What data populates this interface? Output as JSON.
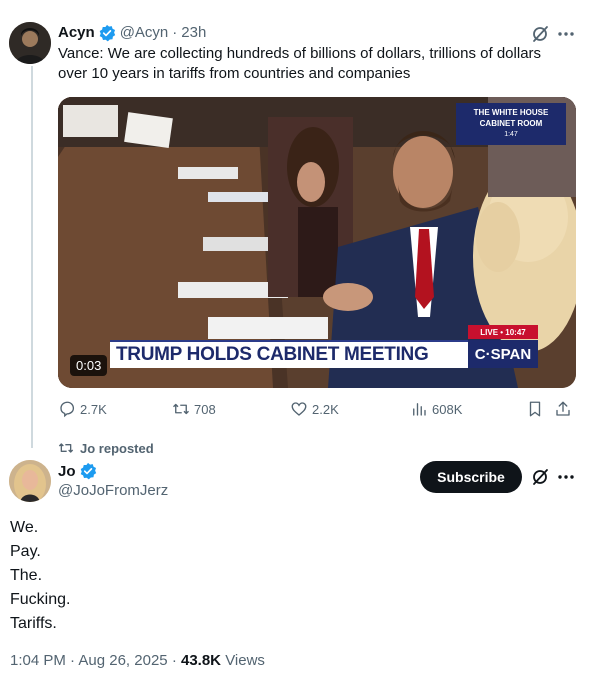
{
  "quoted_tweet": {
    "name": "Acyn",
    "handle": "@Acyn",
    "separator": "·",
    "time": "23h",
    "text": "Vance: We are collecting hundreds of billions of dollars, trillions of dollars over 10 years in tariffs from countries and companies",
    "video": {
      "channel_tag_line1": "THE WHITE HOUSE",
      "channel_tag_line2": "CABINET ROOM",
      "channel_tag_time": "1:47",
      "chyron": "TRUMP HOLDS CABINET MEETING",
      "network": "C·SPAN",
      "live_tag": "LIVE • 10:47",
      "duration": "0:03"
    },
    "actions": {
      "replies": "2.7K",
      "reposts": "708",
      "likes": "2.2K",
      "views": "608K"
    }
  },
  "repost_label": "Jo reposted",
  "tweet": {
    "name": "Jo",
    "handle": "@JoJoFromJerz",
    "subscribe_label": "Subscribe",
    "lines": [
      "We.",
      "Pay.",
      "The.",
      "Fucking.",
      "Tariffs."
    ],
    "time": "1:04 PM",
    "date": "Aug 26, 2025",
    "views_count": "43.8K",
    "views_label": "Views"
  },
  "colors": {
    "verified": "#1d9bf0",
    "text": "#0f1419",
    "muted": "#536471",
    "cspan_blue": "#1d2a6b",
    "live_red": "#c8102e"
  },
  "icons": [
    "verified-icon",
    "grok-icon",
    "more-icon",
    "reply-icon",
    "repost-icon",
    "like-icon",
    "views-icon",
    "bookmark-icon",
    "share-icon"
  ]
}
